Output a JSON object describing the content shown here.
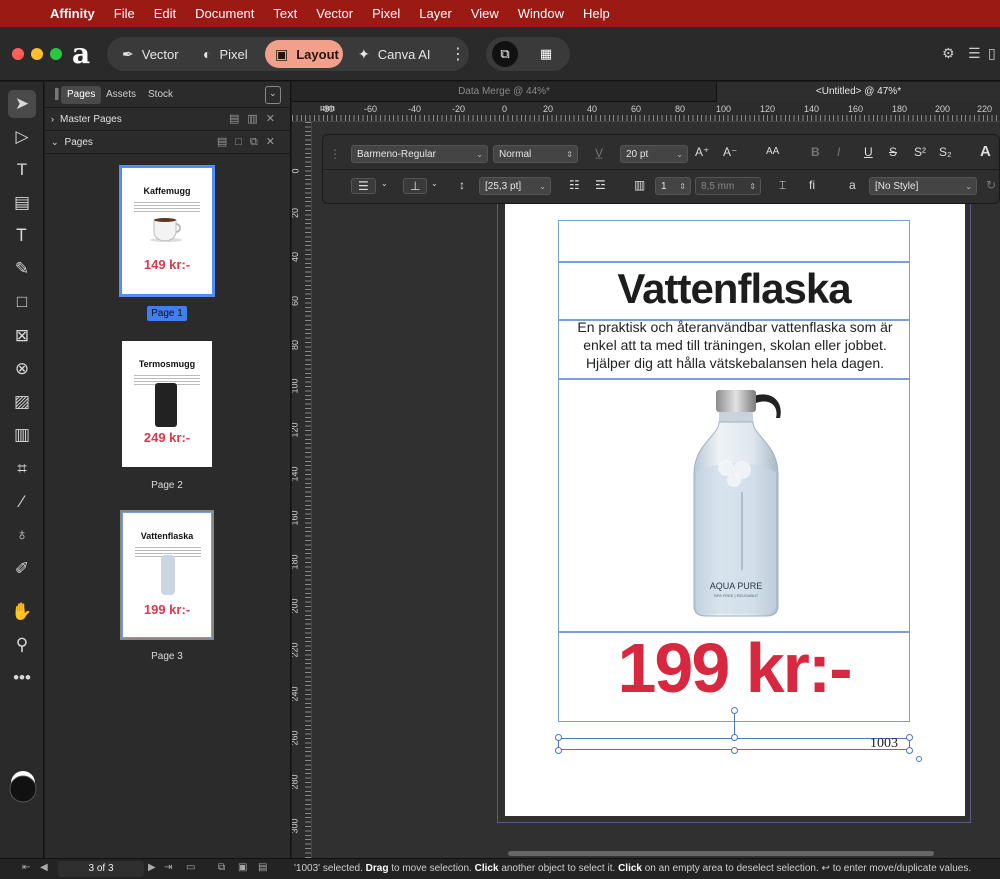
{
  "menubar": {
    "app": "Affinity",
    "items": [
      "File",
      "Edit",
      "Document",
      "Text",
      "Vector",
      "Pixel",
      "Layer",
      "View",
      "Window",
      "Help"
    ]
  },
  "toolbar": {
    "personas": [
      {
        "label": "Vector",
        "icon": "pen-nib-icon"
      },
      {
        "label": "Pixel",
        "icon": "pixel-brush-icon"
      },
      {
        "label": "Layout",
        "icon": "layout-icon",
        "active": true
      },
      {
        "label": "Canva AI",
        "icon": "sparkle-icon"
      }
    ],
    "accent": "#f2a08c"
  },
  "panel": {
    "tabs": [
      "Pages",
      "Assets",
      "Stock"
    ],
    "active_tab": "Pages",
    "sections": {
      "master": "Master Pages",
      "pages": "Pages"
    },
    "pages": [
      {
        "title": "Kaffemugg",
        "price": "149 kr:-",
        "label": "Page 1",
        "selected": true
      },
      {
        "title": "Termosmugg",
        "price": "249 kr:-",
        "label": "Page 2"
      },
      {
        "title": "Vattenflaska",
        "price": "199 kr:-",
        "label": "Page 3"
      }
    ]
  },
  "doc_tabs": {
    "inactive": "Data Merge @ 44%*",
    "active": "<Untitled> @ 47%*"
  },
  "rulers": {
    "h": [
      "mm",
      "-80",
      "-60",
      "-40",
      "-20",
      "0",
      "20",
      "40",
      "60",
      "80",
      "100",
      "120",
      "140",
      "160",
      "180",
      "200",
      "220"
    ],
    "v": [
      "0",
      "20",
      "40",
      "60",
      "80",
      "100",
      "120",
      "140",
      "160",
      "180",
      "200",
      "220",
      "240",
      "260",
      "280",
      "300"
    ]
  },
  "context_toolbar": {
    "font": "Barmeno-Regular",
    "style": "Normal",
    "size": "20 pt",
    "leading": "[25,3 pt]",
    "columns": "1",
    "gutter": "8,5 mm",
    "para_style": "[No Style]"
  },
  "document": {
    "title": "Vattenflaska",
    "description": "En praktisk och återanvändbar vattenflaska som är enkel att ta med till träningen, skolan eller jobbet. Hjälper dig att hålla vätskebalansen hela dagen.",
    "price": "199 kr:-",
    "code": "1003",
    "brand": "AQUA PURE",
    "brand_sub": "BPA FREE | REUSABLE",
    "price_color": "#d8283f"
  },
  "status": {
    "page_indicator": "3 of 3",
    "selected": "'1003' selected.",
    "drag": "Drag",
    "drag_text": "to move selection.",
    "click": "Click",
    "click_text": "another object to select it.",
    "click2": "Click",
    "click2_text": "on an empty area to deselect selection.",
    "enter_text": "↩ to enter move/duplicate values."
  }
}
